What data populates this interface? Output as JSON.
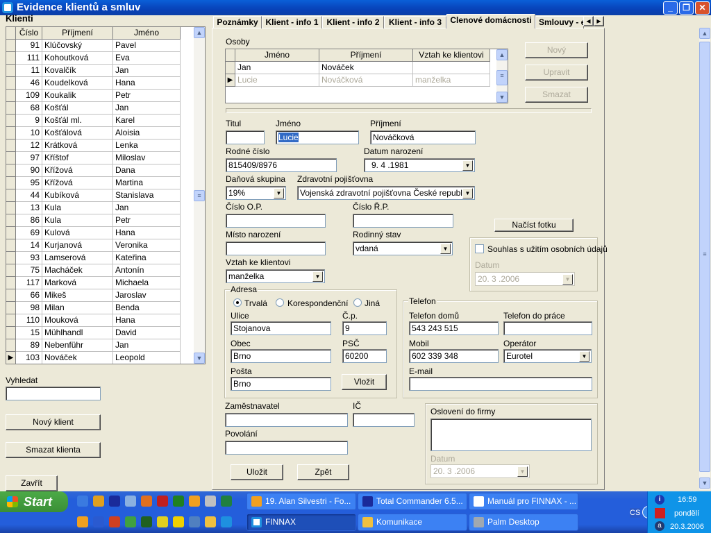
{
  "window": {
    "title": "Evidence klientů a smluv",
    "minimize": "_",
    "maximize": "❐",
    "close": "✕"
  },
  "left": {
    "section": "Klienti",
    "columns": [
      "Číslo",
      "Příjmení",
      "Jméno"
    ],
    "rows": [
      [
        "91",
        "Klúčovský",
        "Pavel"
      ],
      [
        "111",
        "Kohoutková",
        "Eva"
      ],
      [
        "11",
        "Kovalčík",
        "Jan"
      ],
      [
        "46",
        "Koudelková",
        "Hana"
      ],
      [
        "109",
        "Koukalik",
        "Petr"
      ],
      [
        "68",
        "Košťál",
        "Jan"
      ],
      [
        "9",
        "Košťál ml.",
        "Karel"
      ],
      [
        "10",
        "Košťálová",
        "Aloisia"
      ],
      [
        "12",
        "Krátková",
        "Lenka"
      ],
      [
        "97",
        "Kříštof",
        "Miloslav"
      ],
      [
        "90",
        "Křížová",
        "Dana"
      ],
      [
        "95",
        "Křížová",
        "Martina"
      ],
      [
        "44",
        "Kubíková",
        "Stanislava"
      ],
      [
        "13",
        "Kula",
        "Jan"
      ],
      [
        "86",
        "Kula",
        "Petr"
      ],
      [
        "69",
        "Kulová",
        "Hana"
      ],
      [
        "14",
        "Kurjanová",
        "Veronika"
      ],
      [
        "93",
        "Lamserová",
        "Kateřina"
      ],
      [
        "75",
        "Macháček",
        "Antonín"
      ],
      [
        "117",
        "Marková",
        "Michaela"
      ],
      [
        "66",
        "Mikeš",
        "Jaroslav"
      ],
      [
        "98",
        "Milan",
        "Benda"
      ],
      [
        "110",
        "Mouková",
        "Hana"
      ],
      [
        "15",
        "Mühlhandl",
        "David"
      ],
      [
        "89",
        "Nebenführ",
        "Jan"
      ],
      [
        "103",
        "Nováček",
        "Leopold"
      ]
    ],
    "selected_row": 25,
    "search_label": "Vyhledat",
    "search_value": "",
    "new_client": "Nový klient",
    "delete_client": "Smazat klienta",
    "close": "Zavřít"
  },
  "tabs": [
    "Poznámky",
    "Klient - info 1",
    "Klient - info 2",
    "Klient - info 3",
    "Clenové domácnosti",
    "Smlouvy - e"
  ],
  "active_tab": 4,
  "osoby": {
    "label": "Osoby",
    "columns": [
      "Jméno",
      "Příjmení",
      "Vztah ke klientovi"
    ],
    "rows": [
      [
        "Jan",
        "Nováček",
        ""
      ],
      [
        "Lucie",
        "Nováčková",
        "manželka"
      ]
    ],
    "buttons": {
      "new": "Nový",
      "edit": "Upravit",
      "delete": "Smazat"
    }
  },
  "form": {
    "titul": {
      "label": "Titul",
      "value": ""
    },
    "jmeno": {
      "label": "Jméno",
      "value": "Lucie"
    },
    "prijmeni": {
      "label": "Příjmení",
      "value": "Nováčková"
    },
    "rodne_cislo": {
      "label": "Rodné číslo",
      "value": "815409/8976"
    },
    "datum_narozeni": {
      "label": "Datum narození",
      "value": "9. 4 .1981"
    },
    "danova_skupina": {
      "label": "Daňová skupina",
      "value": "19%"
    },
    "pojistovna": {
      "label": "Zdravotní pojišťovna",
      "value": "Vojenská zdravotní pojišťovna České republiky"
    },
    "cislo_op": {
      "label": "Číslo O.P.",
      "value": ""
    },
    "cislo_rp": {
      "label": "Číslo Ř.P.",
      "value": ""
    },
    "misto_narozeni": {
      "label": "Místo narození",
      "value": ""
    },
    "rodinny_stav": {
      "label": "Rodinný stav",
      "value": "vdaná"
    },
    "vztah": {
      "label": "Vztah ke klientovi",
      "value": "manželka"
    },
    "nacist_fotku": "Načíst fotku",
    "souhlas": {
      "label": "Souhlas s užitím osobních údajů",
      "checked": false,
      "datum_label": "Datum",
      "datum": "20. 3 .2006"
    },
    "adresa": {
      "label": "Adresa",
      "radios": [
        "Trvalá",
        "Korespondenční",
        "Jiná"
      ],
      "selected": 0,
      "ulice": {
        "label": "Ulice",
        "value": "Stojanova"
      },
      "cp": {
        "label": "Č.p.",
        "value": "9"
      },
      "obec": {
        "label": "Obec",
        "value": "Brno"
      },
      "psc": {
        "label": "PSČ",
        "value": "60200"
      },
      "posta": {
        "label": "Pošta",
        "value": "Brno"
      },
      "vlozit": "Vložit"
    },
    "telefon": {
      "label": "Telefon",
      "domu": {
        "label": "Telefon domů",
        "value": "543 243 515"
      },
      "prace": {
        "label": "Telefon do práce",
        "value": ""
      },
      "mobil": {
        "label": "Mobil",
        "value": "602 339 348"
      },
      "operator": {
        "label": "Operátor",
        "value": "Eurotel"
      },
      "email": {
        "label": "E-mail",
        "value": ""
      }
    },
    "zamestnavatel": {
      "label": "Zaměstnavatel",
      "value": ""
    },
    "ic": {
      "label": "IČ",
      "value": ""
    },
    "povolani": {
      "label": "Povolání",
      "value": ""
    },
    "ulozit": "Uložit",
    "zpet": "Zpět",
    "osloveni": {
      "label": "Oslovení do firmy",
      "value": "",
      "datum_label": "Datum",
      "datum": "20. 3 .2006"
    }
  },
  "taskbar": {
    "start": "Start",
    "tasks": [
      {
        "label": "19. Alan Silvestri - Fo...",
        "color": "#f0a020"
      },
      {
        "label": "Total Commander 6.5...",
        "color": "#1a2a9a"
      },
      {
        "label": "Manuál pro FINNAX - ...",
        "color": "#ffffff"
      },
      {
        "label": "FINNAX",
        "color": "#ffffff",
        "active": true
      },
      {
        "label": "Komunikace",
        "color": "#f0c040"
      },
      {
        "label": "Palm Desktop",
        "color": "#a0a8b0"
      }
    ],
    "lang": "CS",
    "time": "16:59",
    "day": "pondělí",
    "date": "20.3.2006"
  }
}
